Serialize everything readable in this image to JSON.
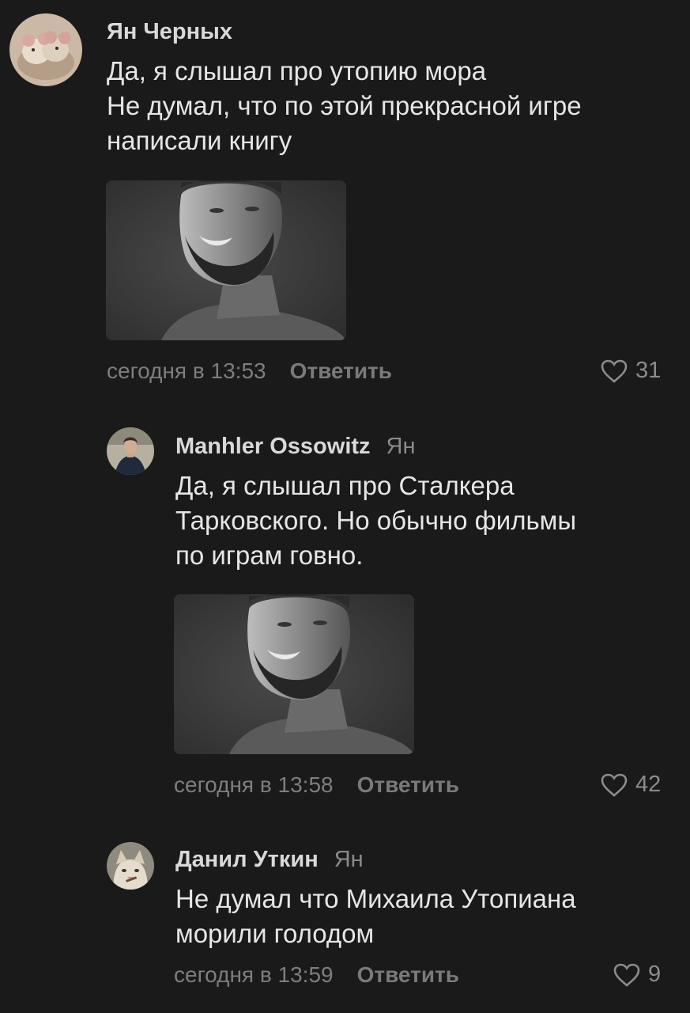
{
  "comments": [
    {
      "author": "Ян Черных",
      "reply_to": "",
      "lines": [
        "Да, я слышал про утопию мора",
        "Не думал, что по этой прекрасной игре",
        "написали книгу"
      ],
      "time": "сегодня в 13:53",
      "reply_label": "Ответить",
      "likes": "31"
    },
    {
      "author": "Manhler Ossowitz",
      "reply_to": "Ян",
      "lines": [
        "Да, я слышал про Сталкера",
        "Тарковского. Но обычно фильмы",
        "по играм говно."
      ],
      "time": "сегодня в 13:58",
      "reply_label": "Ответить",
      "likes": "42"
    },
    {
      "author": "Данил Уткин",
      "reply_to": "Ян",
      "lines": [
        "Не думал что Михаила Утопиана",
        "морили голодом"
      ],
      "time": "сегодня в 13:59",
      "reply_label": "Ответить",
      "likes": "9"
    }
  ],
  "icons": {
    "like": "heart-icon"
  },
  "colors": {
    "background": "#1a1a1a",
    "text": "#e6e6e6",
    "muted": "#7e7e7e"
  }
}
